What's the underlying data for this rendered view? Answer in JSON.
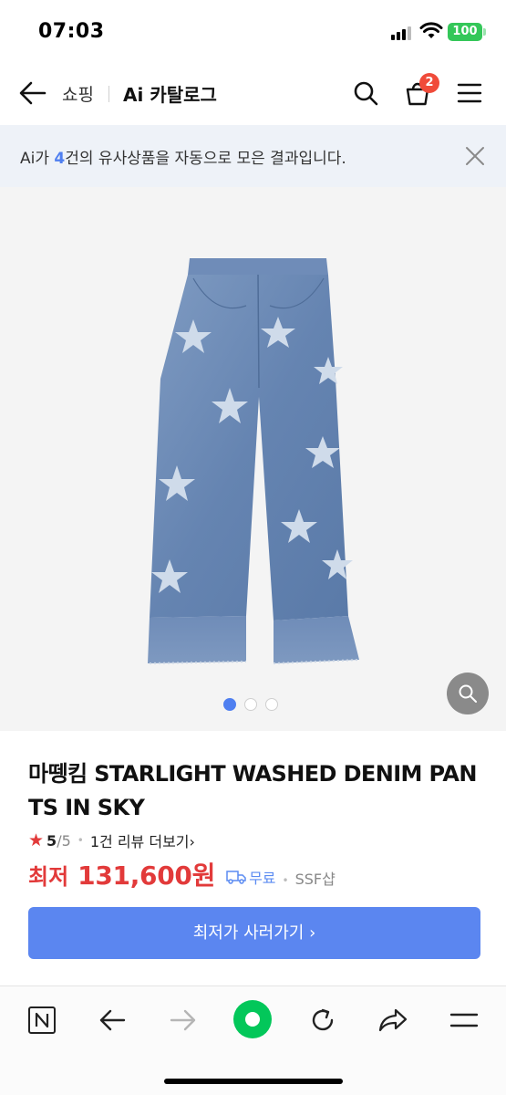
{
  "status_bar": {
    "time": "07:03",
    "battery": "100"
  },
  "header": {
    "breadcrumb_shopping": "쇼핑",
    "title_ai": "Ai",
    "title_catalog": "카탈로그",
    "cart_count": "2"
  },
  "notice": {
    "prefix": "Ai가 ",
    "count": "4",
    "suffix": "건의 유사상품을 자동으로 모은 결과입니다."
  },
  "gallery": {
    "image_count": 3,
    "active_index": 0
  },
  "product": {
    "title": "마뗑킴 STARLIGHT WASHED DENIM PANTS IN SKY",
    "rating_score": "5",
    "rating_max": "/5",
    "review_link": "1건 리뷰 더보기",
    "price_label": "최저",
    "price": "131,600원",
    "delivery": "무료",
    "shop": "SSF샵",
    "buy_button": "최저가 사러가기 ›"
  },
  "icons": [
    "back-arrow-icon",
    "search-icon",
    "cart-icon",
    "menu-icon",
    "close-icon",
    "zoom-icon",
    "truck-icon",
    "naver-icon",
    "browser-back-icon",
    "browser-forward-icon",
    "green-dot-icon",
    "reload-icon",
    "share-icon",
    "more-menu-icon"
  ],
  "colors": {
    "accent": "#5b86f0",
    "price": "#e23a3a",
    "badge": "#f04b3a",
    "notice_bg": "#eef2f8",
    "green": "#03c75a"
  }
}
